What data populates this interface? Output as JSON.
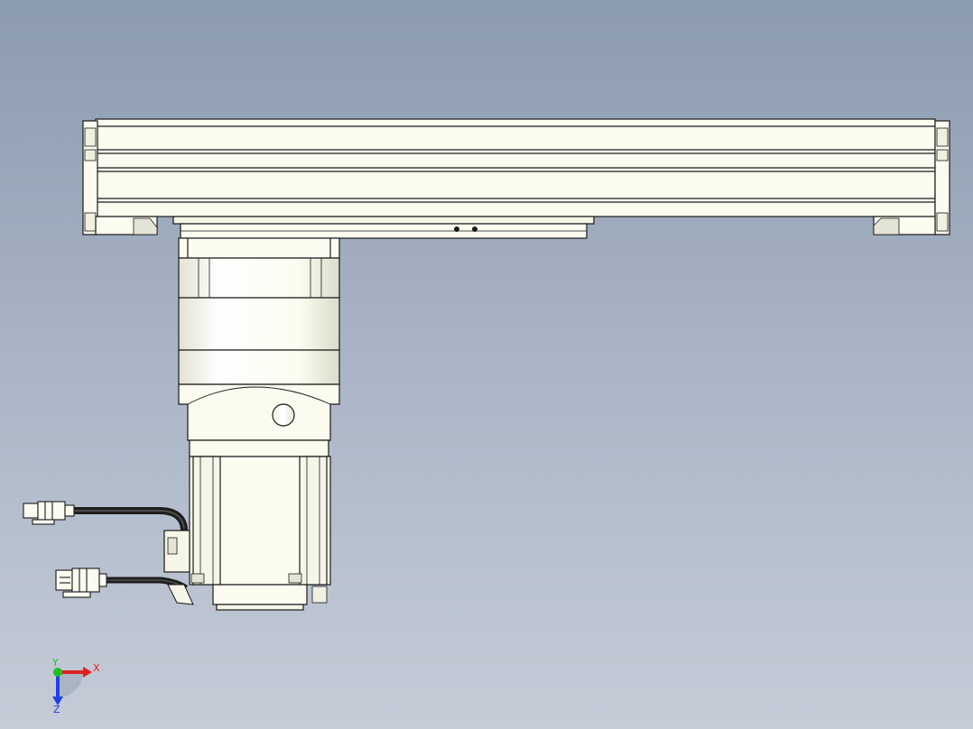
{
  "viewport": {
    "background_top": "#8b9bb0",
    "background_bottom": "#c5ccd8",
    "part_fill": "#fbfbf0",
    "part_shade": "#e4e4d6",
    "edge_color": "#1a1a1a",
    "cable_color": "#1e1e1e"
  },
  "triad": {
    "x_label": "X",
    "y_label": "Y",
    "z_label": "Z",
    "x_color": "#e02020",
    "y_color": "#20c020",
    "z_color": "#2040e0"
  }
}
